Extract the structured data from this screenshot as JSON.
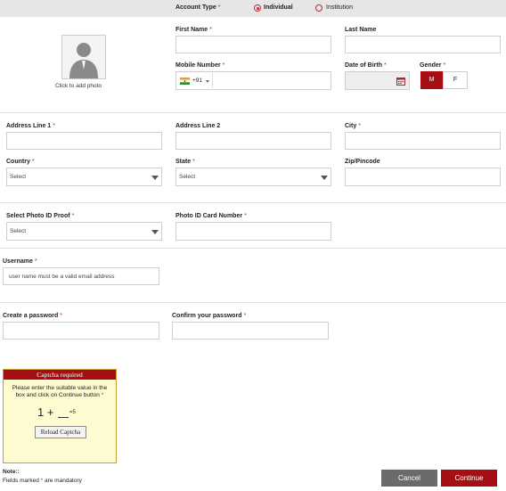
{
  "account_type": {
    "label": "Account Type",
    "options": [
      "Individual",
      "Institution"
    ],
    "selected": "Individual"
  },
  "photo": {
    "caption": "Click to add photo"
  },
  "fields": {
    "first_name": "First Name",
    "last_name": "Last Name",
    "mobile_number": "Mobile Number",
    "country_code": "+91",
    "date_of_birth": "Date of Birth",
    "gender": "Gender",
    "gender_options": [
      "M",
      "F"
    ],
    "gender_selected": "M",
    "address1": "Address Line 1",
    "address2": "Address Line 2",
    "city": "City",
    "country": "Country",
    "state": "State",
    "zip": "Zip/Pincode",
    "select_placeholder": "Select",
    "photo_id_proof": "Select Photo ID Proof",
    "photo_id_number": "Photo ID Card Number",
    "username": "Username",
    "username_placeholder": "user name must be a valid email address",
    "create_password": "Create a password",
    "confirm_password": "Confirm your password"
  },
  "required_mark": "*",
  "captcha": {
    "title": "Captcha required",
    "instructions": "Please enter the suitable value in the box and click on Continue button",
    "equation_left": "1 +",
    "equation_right": "=5",
    "reload_label": "Reload Captcha"
  },
  "note": {
    "title": "Note::",
    "text_before": "Fields marked",
    "text_after": "are mandatory"
  },
  "buttons": {
    "cancel": "Cancel",
    "continue": "Continue"
  },
  "colors": {
    "accent": "#a50f14",
    "topbar": "#e6e6e6",
    "captcha_bg": "#fffbd0",
    "captcha_border": "#c8a030",
    "cancel": "#6b6b6b"
  }
}
